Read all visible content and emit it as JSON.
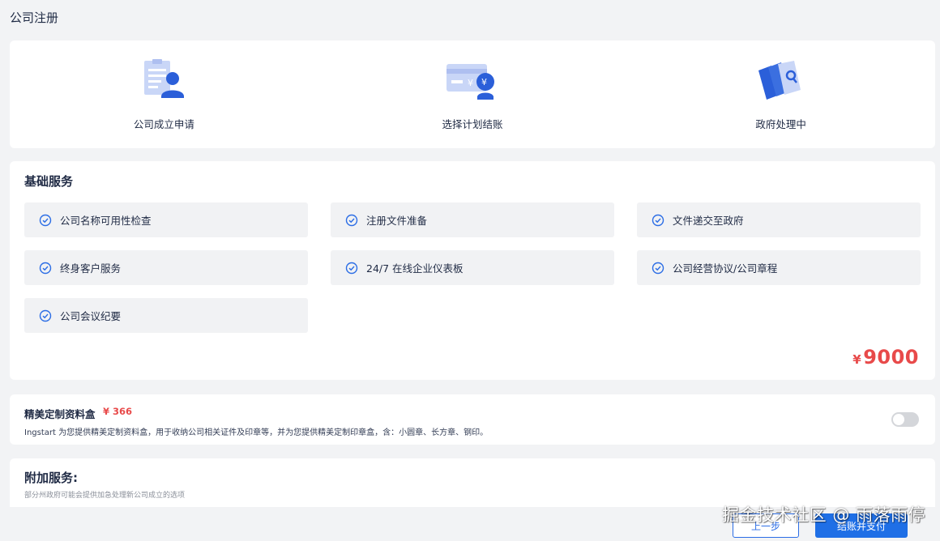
{
  "page": {
    "title": "公司注册"
  },
  "steps": [
    {
      "label": "公司成立申请",
      "icon": "document-person-icon"
    },
    {
      "label": "选择计划结账",
      "icon": "payment-card-icon"
    },
    {
      "label": "政府处理中",
      "icon": "documents-stack-icon"
    }
  ],
  "basic": {
    "title": "基础服务",
    "items": [
      {
        "label": "公司名称可用性检查"
      },
      {
        "label": "注册文件准备"
      },
      {
        "label": "文件递交至政府"
      },
      {
        "label": "终身客户服务"
      },
      {
        "label": "24/7 在线企业仪表板"
      },
      {
        "label": "公司经营协议/公司章程"
      },
      {
        "label": "公司会议纪要"
      }
    ],
    "price_symbol": "¥",
    "price_value": "9000"
  },
  "box": {
    "title": "精美定制资料盒",
    "price": "¥ 366",
    "description": "Ingstart 为您提供精美定制资料盒，用于收纳公司相关证件及印章等，并为您提供精美定制印章盒，含：小圆章、长方章、钢印。",
    "toggle_on": false
  },
  "addon": {
    "title": "附加服务:",
    "subtitle": "部分州政府可能会提供加急处理新公司成立的选项"
  },
  "buttons": {
    "prev": "上一步",
    "next": "结账并支付"
  },
  "watermark": "掘金技术社区 @ 雨落雨停",
  "colors": {
    "accent": "#1f6fe6",
    "price": "#e84a4a",
    "icon_blue": "#2b5fd9",
    "icon_light": "#c9d6f7"
  }
}
